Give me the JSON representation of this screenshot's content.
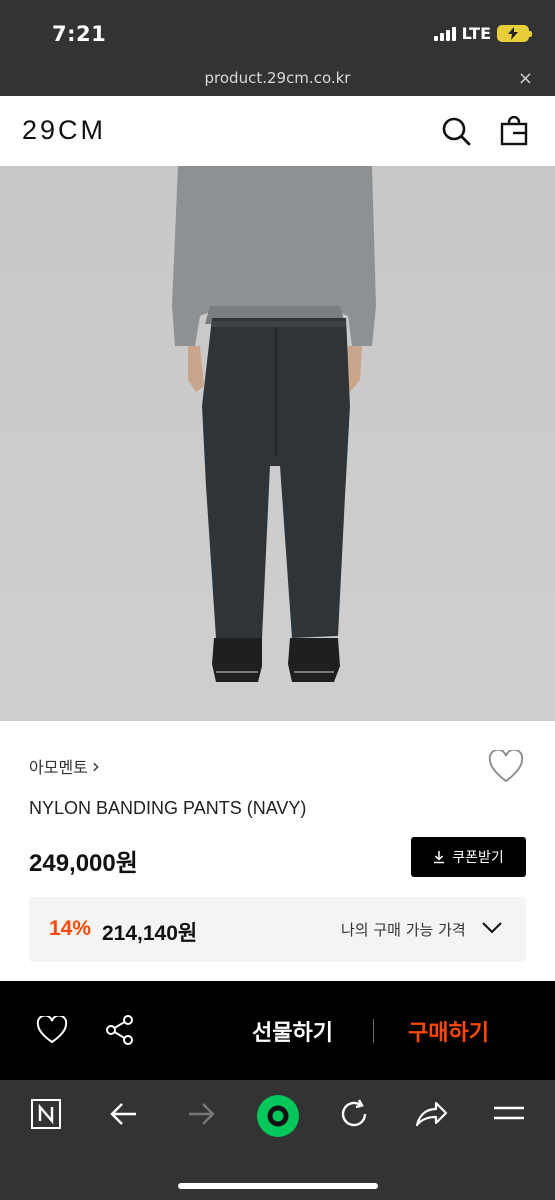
{
  "status_bar": {
    "time": "7:21",
    "network": "LTE"
  },
  "browser": {
    "url": "product.29cm.co.kr",
    "close_icon": "×"
  },
  "header": {
    "logo": "29CM",
    "icons": [
      "search-icon",
      "shopping-bag-icon"
    ]
  },
  "product": {
    "brand": "아모멘토",
    "brand_chevron": "›",
    "name": "NYLON BANDING PANTS (NAVY)",
    "price": "249,000원",
    "coupon_label": "쿠폰받기",
    "discount_percent": "14%",
    "discount_price": "214,140원",
    "discount_label": "나의 구매 가능 가격"
  },
  "purchase_bar": {
    "gift_label": "선물하기",
    "buy_label": "구매하기"
  },
  "toolbar": {
    "icons": [
      "naver-n-icon",
      "back-arrow-icon",
      "forward-arrow-icon",
      "green-dot-icon",
      "reload-icon",
      "share-arrow-icon",
      "menu-icon"
    ]
  },
  "colors": {
    "accent": "#ff4800",
    "chrome": "#333333",
    "naver_green": "#03c75a"
  }
}
